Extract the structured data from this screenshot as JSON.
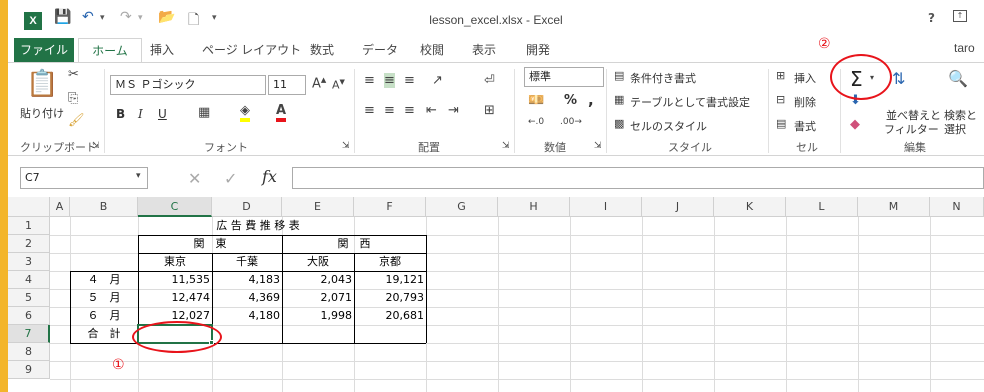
{
  "title": "lesson_excel.xlsx - Excel",
  "help": "?",
  "tabs": {
    "file": "ファイル",
    "home": "ホーム",
    "insert": "挿入",
    "layout": "ページ レイアウト",
    "formulas": "数式",
    "data": "データ",
    "review": "校閲",
    "view": "表示",
    "dev": "開発",
    "user": "taro"
  },
  "ribbon": {
    "clipboard": {
      "paste": "貼り付け",
      "label": "クリップボード"
    },
    "font": {
      "name": "ＭＳ Ｐゴシック",
      "size": "11",
      "label": "フォント",
      "bold": "B",
      "italic": "I",
      "underline": "U"
    },
    "align": {
      "label": "配置"
    },
    "number": {
      "format": "標準",
      "label": "数値",
      "percent": "%",
      "comma": ","
    },
    "style": {
      "cond": "条件付き書式",
      "table": "テーブルとして書式設定",
      "cell": "セルのスタイル",
      "label": "スタイル"
    },
    "cells": {
      "insert": "挿入",
      "delete": "削除",
      "format": "書式",
      "label": "セル"
    },
    "edit": {
      "sort1": "並べ替えと",
      "sort2": "フィルター",
      "find1": "検索と",
      "find2": "選択",
      "label": "編集",
      "sigma": "Σ"
    }
  },
  "namebox": "C7",
  "fx": "fx",
  "columns": [
    "A",
    "B",
    "C",
    "D",
    "E",
    "F",
    "G",
    "H",
    "I",
    "J",
    "K",
    "L",
    "M",
    "N"
  ],
  "rows": [
    "1",
    "2",
    "3",
    "4",
    "5",
    "6",
    "7",
    "8",
    "9"
  ],
  "sheet": {
    "title": "広 告 費 推 移 表",
    "kanto": "関　東",
    "kansai": "関　西",
    "tokyo": "東京",
    "chiba": "千葉",
    "osaka": "大阪",
    "kyoto": "京都",
    "r4": [
      "４　月",
      "11,535",
      "4,183",
      "2,043",
      "19,121"
    ],
    "r5": [
      "５　月",
      "12,474",
      "4,369",
      "2,071",
      "20,793"
    ],
    "r6": [
      "６　月",
      "12,027",
      "4,180",
      "1,998",
      "20,681"
    ],
    "r7": "合　計"
  },
  "annotations": {
    "one": "①",
    "two": "②"
  },
  "colors": {
    "excel_green": "#217346",
    "annotation_red": "#e8141b"
  }
}
